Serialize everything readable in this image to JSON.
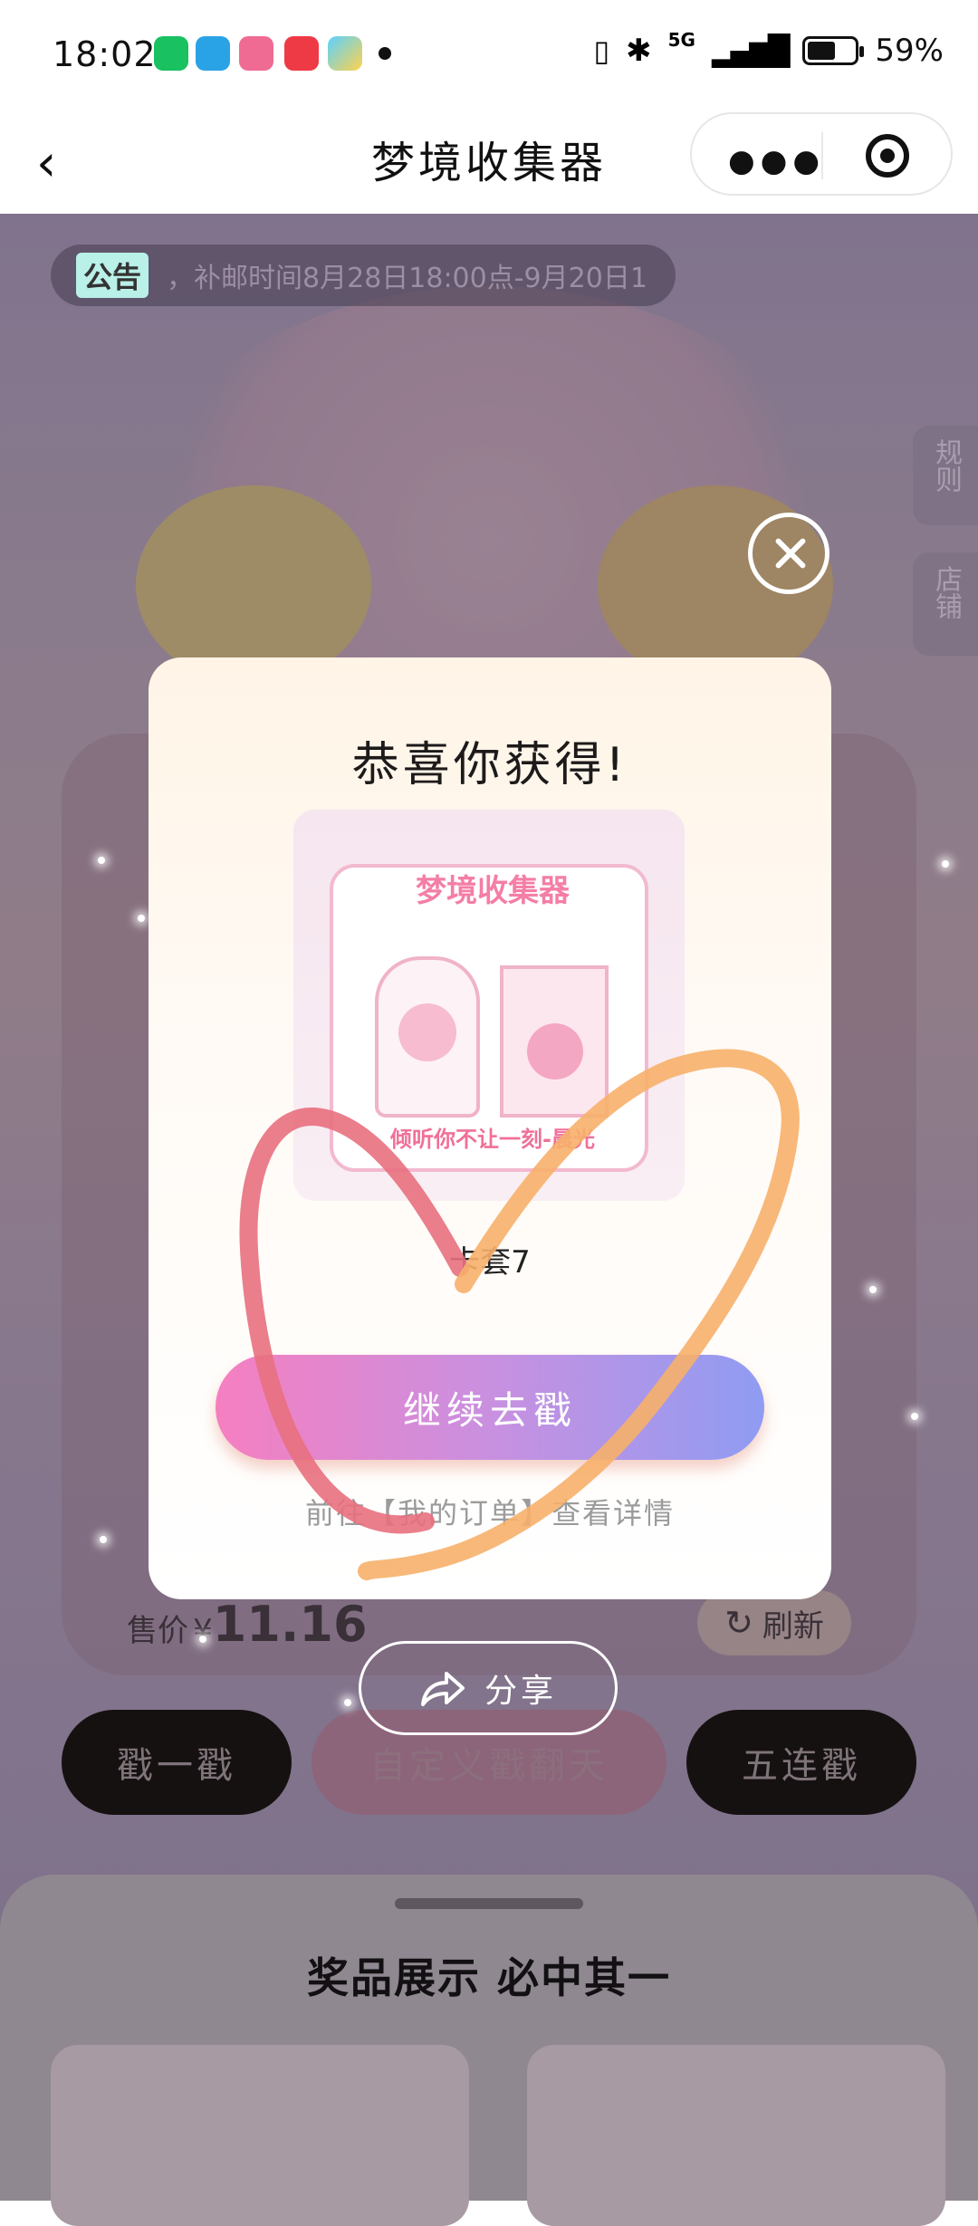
{
  "status_bar": {
    "time": "18:02",
    "network": "5G",
    "battery_text": "59%",
    "battery_level": 0.59
  },
  "navbar": {
    "title": "梦境收集器",
    "back_icon": "chevron-left-icon",
    "more_icon": "more-dots-icon",
    "close_icon": "target-icon"
  },
  "announcement": {
    "tag": "公告",
    "text": "，补邮时间8月28日18:00点-9月20日1"
  },
  "side_tabs": [
    {
      "label": "规则"
    },
    {
      "label": "店铺"
    }
  ],
  "price": {
    "label": "售价",
    "currency": "¥",
    "value": "11.16"
  },
  "refresh": {
    "label": "刷新"
  },
  "share": {
    "label": "分享"
  },
  "actions": {
    "single": "戳一戳",
    "custom": "自定义戳翻天",
    "five": "五连戳"
  },
  "prize_panel": {
    "title": "奖品展示 必中其一"
  },
  "modal": {
    "title": "恭喜你获得!",
    "image_logo_text": "梦境收集器",
    "image_caption": "倾听你不让一刻-晨光",
    "prize_name": "卡套7",
    "continue_label": "继续去戳",
    "order_link": "前往【我的订单】查看详情"
  },
  "colors": {
    "accent_gradient_start": "#f57fc0",
    "accent_gradient_end": "#8f9cf2",
    "scribble_pink": "#e8707e",
    "scribble_orange": "#f7b06a"
  }
}
